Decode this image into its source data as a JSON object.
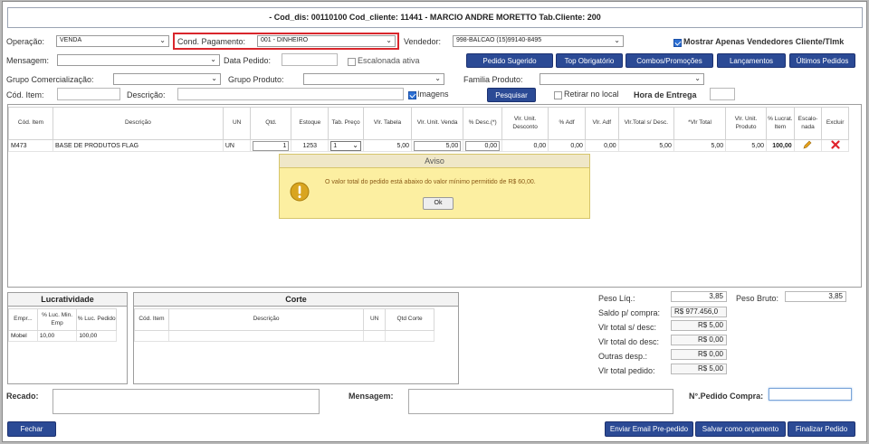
{
  "header": {
    "title": "- Cod_dis: 00110100 Cod_cliente: 11441 - MARCIO ANDRE MORETTO Tab.Cliente: 200"
  },
  "form": {
    "operacao_label": "Operação:",
    "operacao_value": "VENDA",
    "cond_pagamento_label": "Cond. Pagamento:",
    "cond_pagamento_value": "001 - DINHEIRO",
    "vendedor_label": "Vendedor:",
    "vendedor_value": "998-BALCAO (15)99140-8495",
    "mostrar_label": "Mostrar Apenas Vendedores Cliente/Tlmk",
    "mensagem_label": "Mensagem:",
    "data_pedido_label": "Data Pedido:",
    "escalonada_label": "Escalonada ativa",
    "grupo_comercial_label": "Grupo Comercialização:",
    "grupo_produto_label": "Grupo Produto:",
    "familia_produto_label": "Familia Produto:",
    "cod_item_label": "Cód. Item:",
    "descricao_label": "Descrição:",
    "imagens_label": "Imagens",
    "pesquisar_label": "Pesquisar",
    "retirar_label": "Retirar no local",
    "hora_entrega_label": "Hora de Entrega"
  },
  "toolbar": {
    "pedido_sugerido": "Pedido Sugerido",
    "top_obrigatorio": "Top Obrigatório",
    "combos": "Combos/Promoções",
    "lancamentos": "Lançamentos",
    "ultimos_pedidos": "Últimos Pedidos"
  },
  "items_table": {
    "headers": [
      "Cód. Item",
      "Descrição",
      "UN",
      "Qtd.",
      "Estoque",
      "Tab. Preço",
      "Vlr. Tabela",
      "Vlr. Unit. Venda",
      "% Desc.(*)",
      "Vlr. Unit. Desconto",
      "% Adf",
      "Vlr. Adf",
      "Vlr.Total s/ Desc.",
      "*Vlr Total",
      "Vlr. Unit. Produto",
      "% Lucrat. Item",
      "Escalo-nada",
      "Excluir"
    ],
    "row": {
      "cod": "M473",
      "descricao": "BASE DE PRODUTOS FLAG",
      "un": "UN",
      "qtd": "1",
      "estoque": "1253",
      "tab_preco": "1",
      "vlr_tabela": "5,00",
      "vlr_unit_venda": "5,00",
      "desc": "0,00",
      "vlr_unit_desc": "0,00",
      "adf": "0,00",
      "vlr_adf": "0,00",
      "total_sdesc": "5,00",
      "total": "5,00",
      "unit_prod": "5,00",
      "lucrat": "100,00"
    }
  },
  "dialog": {
    "title": "Aviso",
    "message": "O valor total do pedido está abaixo do valor mínimo permitido de R$ 60,00.",
    "ok": "Ok"
  },
  "lucratividade": {
    "title": "Lucratividade",
    "headers": [
      "Empr...",
      "% Luc. Min. Emp",
      "% Luc. Pedido"
    ],
    "row": [
      "Mobel",
      "10,00",
      "100,00"
    ]
  },
  "corte": {
    "title": "Corte",
    "headers": [
      "Cód. Item",
      "Descrição",
      "UN",
      "Qtd Corte"
    ]
  },
  "totals": {
    "peso_liq_label": "Peso Líq.:",
    "peso_liq": "3,85",
    "peso_bruto_label": "Peso Bruto:",
    "peso_bruto": "3,85",
    "saldo_label": "Saldo p/ compra:",
    "saldo": "R$ 977.456,0",
    "vlr_sdesc_label": "Vlr total s/ desc:",
    "vlr_sdesc": "R$ 5,00",
    "vlr_desc_label": "Vlr total do desc:",
    "vlr_desc": "R$ 0,00",
    "outras_label": "Outras desp.:",
    "outras": "R$ 0,00",
    "vlr_pedido_label": "Vlr total pedido:",
    "vlr_pedido": "R$ 5,00"
  },
  "bottom": {
    "recado_label": "Recado:",
    "mensagem_label": "Mensagem:",
    "npedido_label": "N°.Pedido Compra:",
    "fechar": "Fechar",
    "enviar_email": "Enviar Email Pre-pedido",
    "salvar_orcamento": "Salvar como orçamento",
    "finalizar": "Finalizar Pedido"
  },
  "colors": {
    "button": "#2b4a95",
    "dialog_bg": "#fcefa1",
    "highlight_border": "#d9262c",
    "delete_icon": "#e0232b",
    "edit_icon": "#e8a21a"
  }
}
